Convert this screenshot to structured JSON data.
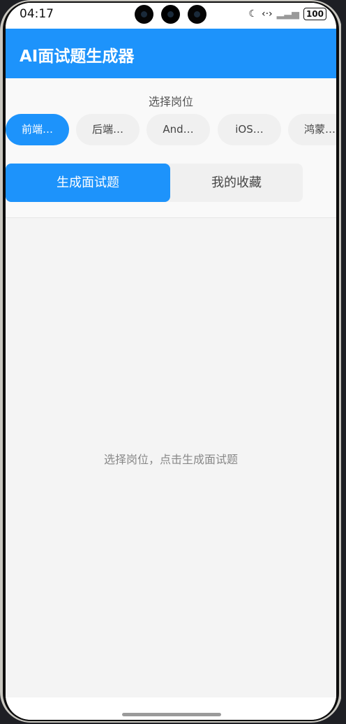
{
  "status": {
    "time": "04:17",
    "battery": "100"
  },
  "app": {
    "title": "AI面试题生成器"
  },
  "selector": {
    "label": "选择岗位",
    "positions": [
      "前端…",
      "后端…",
      "And…",
      "iOS…",
      "鸿蒙…"
    ],
    "active_index": 0
  },
  "tabs": [
    {
      "label": "生成面试题",
      "active": true
    },
    {
      "label": "我的收藏",
      "active": false
    }
  ],
  "main": {
    "empty_message": "选择岗位，点击生成面试题"
  },
  "colors": {
    "accent": "#1d93fb",
    "background": "#f4f4f4"
  }
}
